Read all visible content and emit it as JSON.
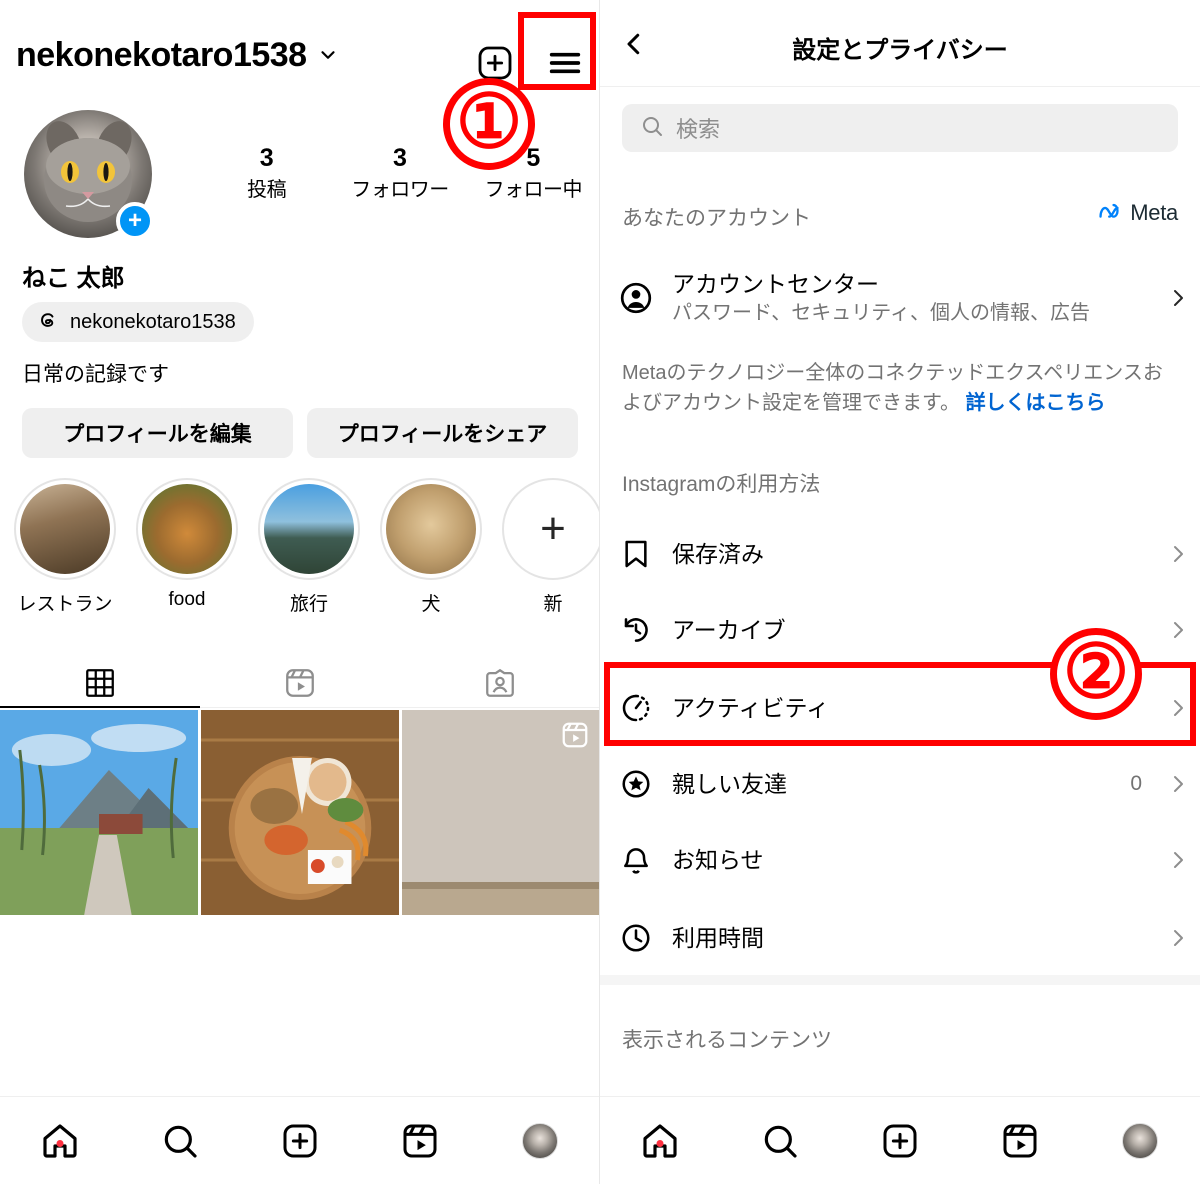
{
  "left_panel": {
    "header": {
      "username": "nekonekotaro1538",
      "chevron_icon": "chevron-down-icon",
      "add_icon": "add-post-icon",
      "menu_icon": "hamburger-menu-icon"
    },
    "profile": {
      "avatar_icon": "profile-avatar",
      "add_story_label": "+",
      "stats": [
        {
          "number": "3",
          "label": "投稿"
        },
        {
          "number": "3",
          "label": "フォロワー"
        },
        {
          "number": "5",
          "label": "フォロー中"
        }
      ],
      "full_name": "ねこ 太郎",
      "threads_icon": "threads-icon",
      "threads_handle": "nekonekotaro1538",
      "bio": "日常の記録です"
    },
    "actions": {
      "edit_profile": "プロフィールを編集",
      "share_profile": "プロフィールをシェア"
    },
    "highlights": [
      {
        "label": "レストラン",
        "type": "photo"
      },
      {
        "label": "food",
        "type": "photo"
      },
      {
        "label": "旅行",
        "type": "photo"
      },
      {
        "label": "犬",
        "type": "photo"
      },
      {
        "label": "新",
        "type": "new"
      }
    ],
    "tabs": [
      {
        "icon": "grid-icon",
        "active": true
      },
      {
        "icon": "reels-icon",
        "active": false
      },
      {
        "icon": "tagged-icon",
        "active": false
      }
    ],
    "grid": [
      {
        "icon": "photo-landscape"
      },
      {
        "icon": "photo-food"
      },
      {
        "icon": "photo-room",
        "badge": "reels-badge-icon"
      }
    ]
  },
  "right_panel": {
    "header": {
      "back_icon": "back-chevron-icon",
      "title": "設定とプライバシー"
    },
    "search": {
      "icon": "search-icon",
      "placeholder": "検索"
    },
    "section_account": {
      "header": "あなたのアカウント",
      "meta_logo_icon": "meta-infinity-icon",
      "meta_word": "Meta",
      "rows": [
        {
          "icon": "account-circle-icon",
          "title": "アカウントセンター",
          "sub": "パスワード、セキュリティ、個人の情報、広告",
          "chevron": "chevron-right-icon"
        }
      ],
      "note": "Metaのテクノロジー全体のコネクテッドエクスペリエンスおよびアカウント設定を管理できます。",
      "note_link": "詳しくはこちら"
    },
    "section_usage": {
      "header": "Instagramの利用方法",
      "rows": [
        {
          "icon": "bookmark-icon",
          "title": "保存済み",
          "value": "",
          "chevron": "chevron-right-icon"
        },
        {
          "icon": "archive-clock-icon",
          "title": "アーカイブ",
          "value": "",
          "chevron": "chevron-right-icon"
        },
        {
          "icon": "activity-icon",
          "title": "アクティビティ",
          "value": "",
          "chevron": "chevron-right-icon"
        },
        {
          "icon": "close-friends-star-icon",
          "title": "親しい友達",
          "value": "0",
          "chevron": "chevron-right-icon"
        },
        {
          "icon": "bell-icon",
          "title": "お知らせ",
          "value": "",
          "chevron": "chevron-right-icon"
        },
        {
          "icon": "clock-icon",
          "title": "利用時間",
          "value": "",
          "chevron": "chevron-right-icon"
        }
      ]
    },
    "section_content": {
      "header": "表示されるコンテンツ"
    }
  },
  "bottom_nav": {
    "items": [
      {
        "icon": "home-icon",
        "active": true,
        "dot": true
      },
      {
        "icon": "search-icon",
        "active": false,
        "dot": false
      },
      {
        "icon": "create-icon",
        "active": false,
        "dot": false
      },
      {
        "icon": "reels-icon",
        "active": false,
        "dot": false
      },
      {
        "icon": "profile-avatar-icon",
        "active": false,
        "dot": false
      }
    ]
  },
  "annotations": [
    {
      "number": "①",
      "target": "hamburger-menu-button"
    },
    {
      "number": "②",
      "target": "activity-row"
    }
  ],
  "colors": {
    "accent_blue": "#0095f6",
    "link_blue": "#0064d1",
    "annotation_red": "#ff0000",
    "muted_gray": "#737373",
    "chip_gray": "#efefef",
    "notification_red": "#ff3040"
  }
}
